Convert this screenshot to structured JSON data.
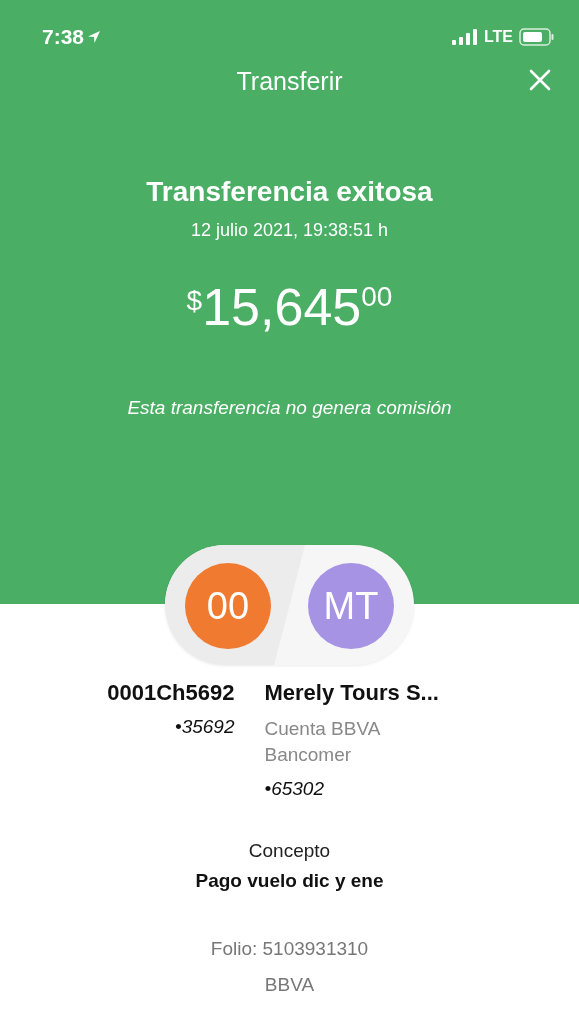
{
  "status_bar": {
    "time": "7:38",
    "network": "LTE"
  },
  "header": {
    "title": "Transferir"
  },
  "result": {
    "title": "Transferencia exitosa",
    "date": "12 julio 2021, 19:38:51 h",
    "currency": "$",
    "amount": "15,645",
    "cents": "00",
    "note": "Esta transferencia no genera comisión"
  },
  "accounts": [
    {
      "initials": "00",
      "color": "#f07a30",
      "name": "0001Ch5692",
      "number": "•35692"
    },
    {
      "initials": "MT",
      "color": "#a793e4",
      "name": "Merely Tours S...",
      "bank": "Cuenta BBVA Bancomer",
      "number": "•65302"
    }
  ],
  "concept": {
    "label": "Concepto",
    "value": "Pago vuelo dic y ene"
  },
  "folio": "Folio: 5103931310",
  "bank": "BBVA"
}
